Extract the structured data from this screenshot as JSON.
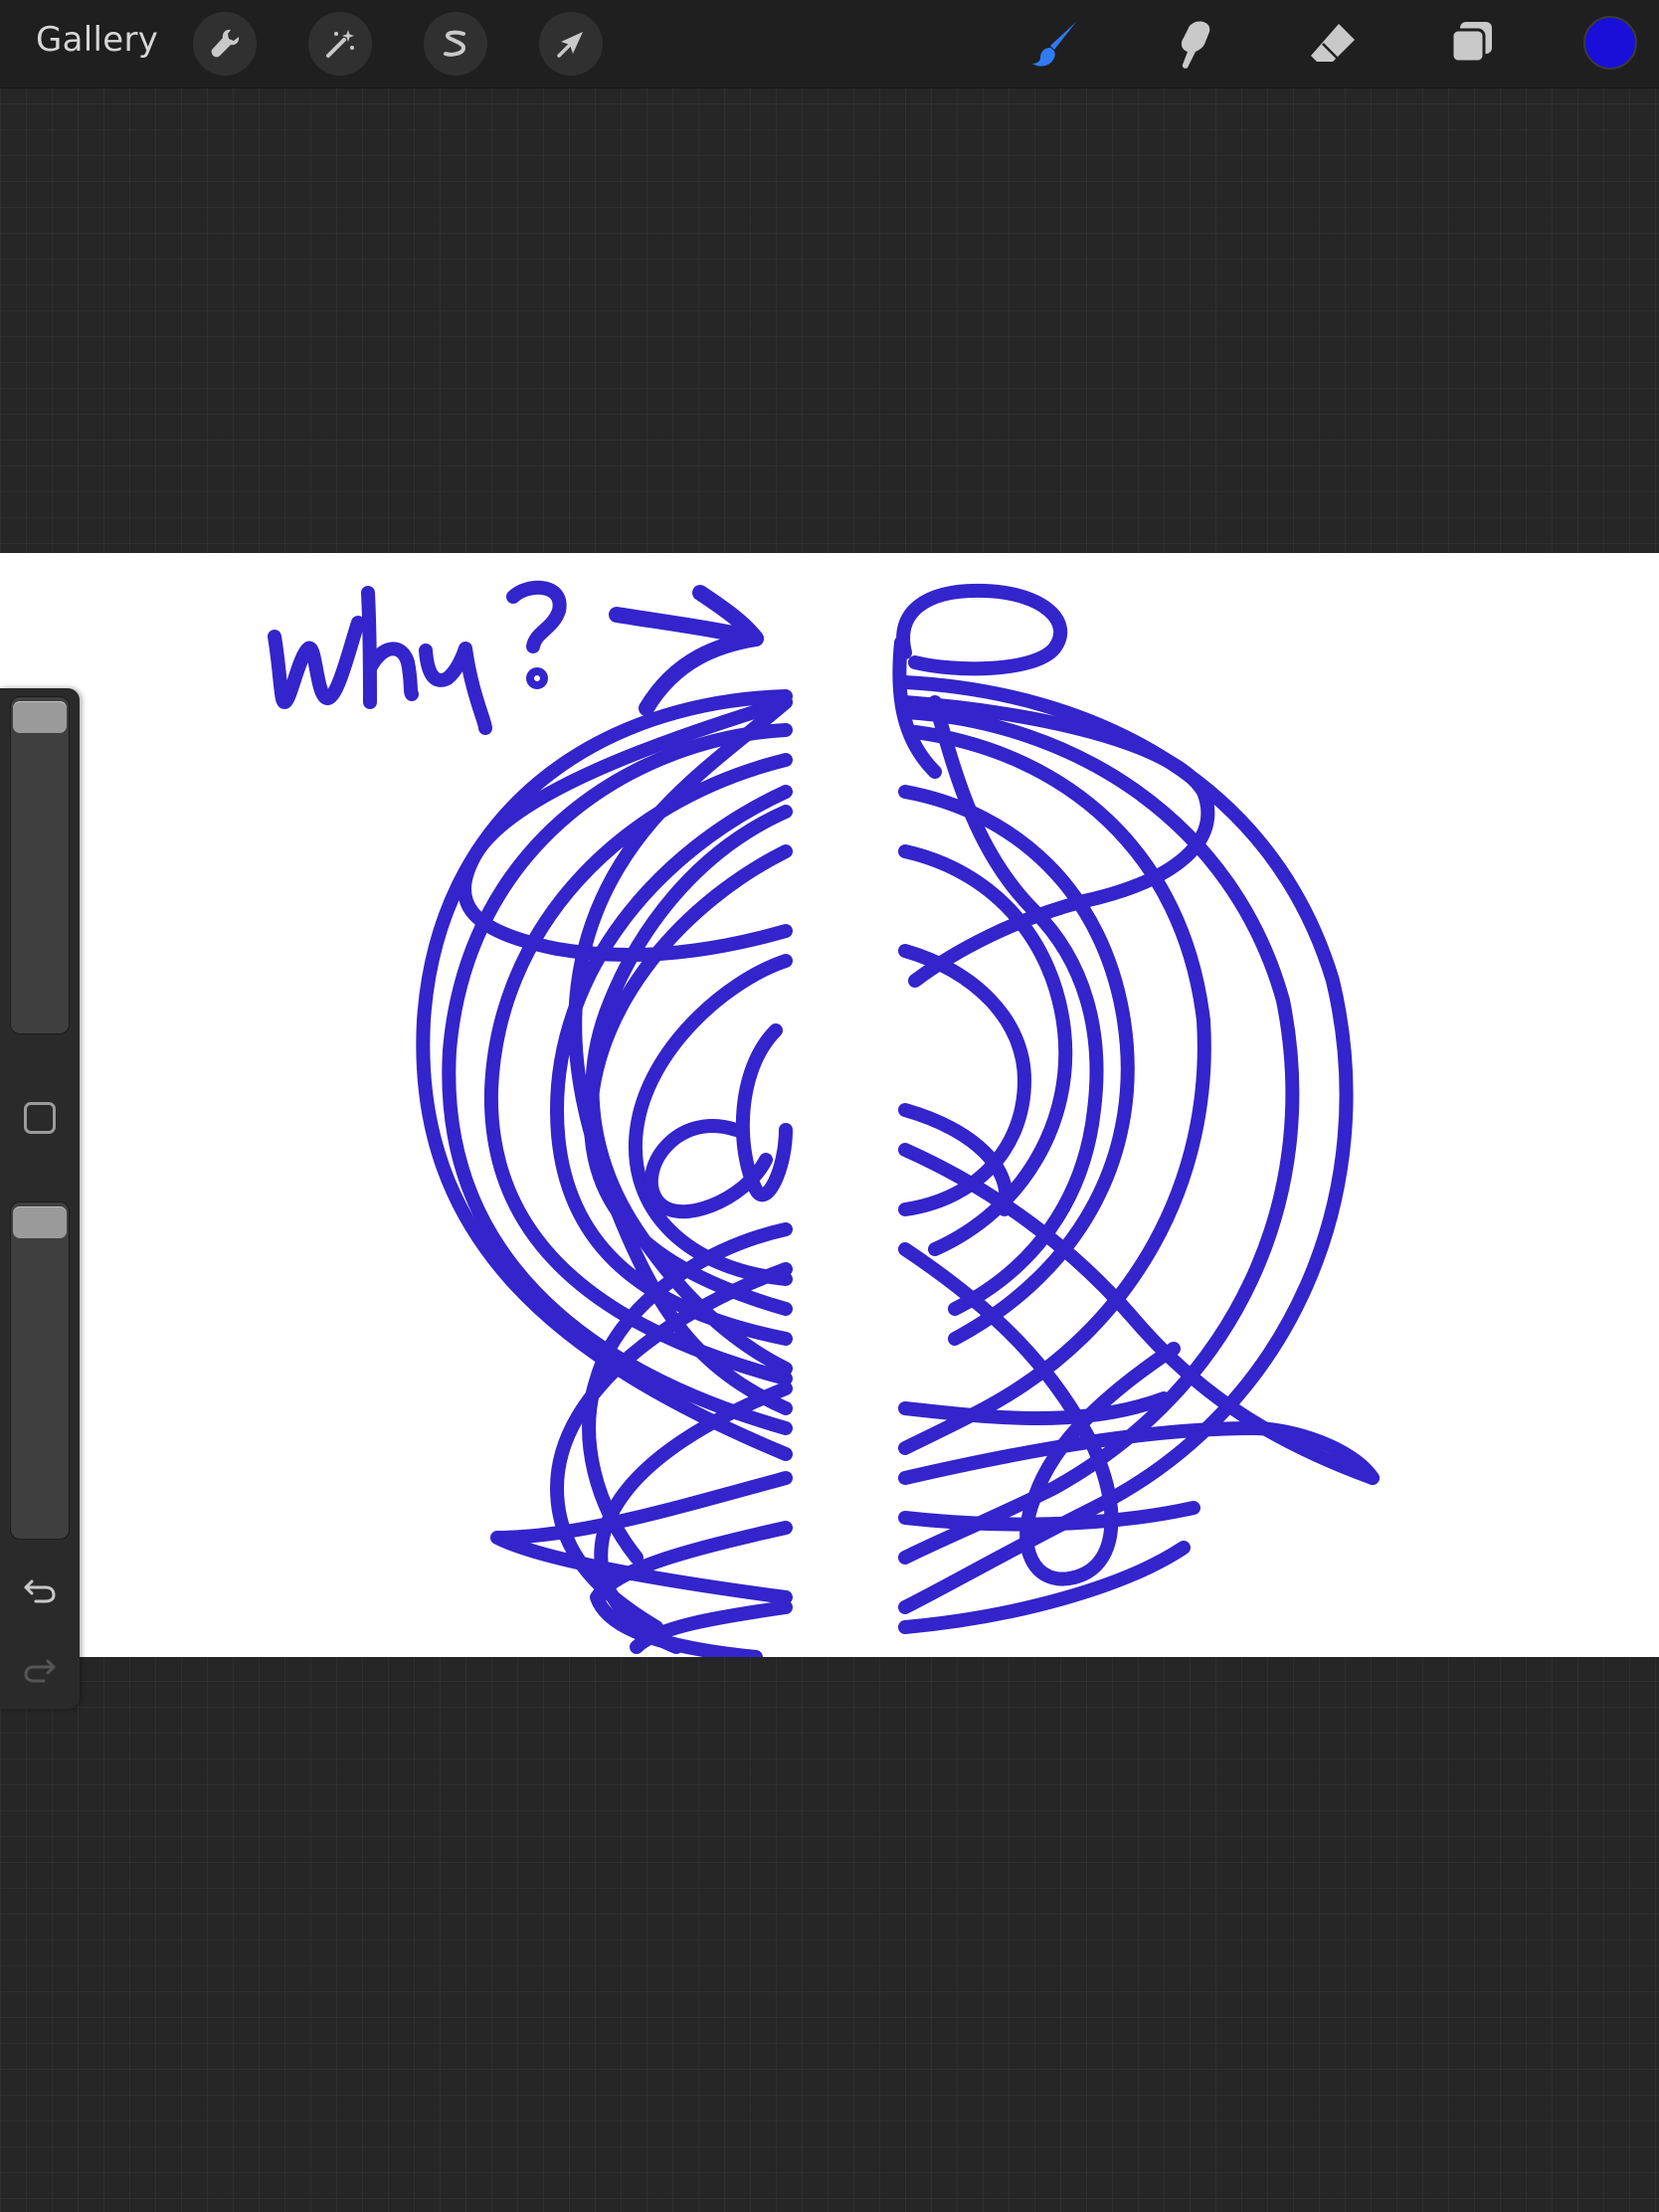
{
  "topbar": {
    "gallery_label": "Gallery",
    "left_tools": [
      {
        "name": "actions",
        "icon": "wrench-icon"
      },
      {
        "name": "adjustments",
        "icon": "magic-wand-icon"
      },
      {
        "name": "selection",
        "icon": "selection-s-icon"
      },
      {
        "name": "transform",
        "icon": "arrow-cursor-icon"
      }
    ],
    "right_tools": [
      {
        "name": "brush",
        "icon": "brush-icon",
        "active": true
      },
      {
        "name": "smudge",
        "icon": "smudge-icon",
        "active": false
      },
      {
        "name": "eraser",
        "icon": "eraser-icon",
        "active": false
      },
      {
        "name": "layers",
        "icon": "layers-icon",
        "active": false
      }
    ],
    "current_color": "#1a0fd8"
  },
  "canvas": {
    "background": "#ffffff",
    "stroke_color": "#2414c8",
    "handwritten_text": "why?"
  },
  "sidebar": {
    "brush_size_level": 0.02,
    "brush_opacity_level": 0.02,
    "undo_icon": "undo-icon",
    "redo_icon": "redo-icon",
    "redo_enabled": false
  },
  "colors": {
    "accent_active_tool": "#2f7bf5",
    "ui_icon": "#c9c9c9"
  }
}
